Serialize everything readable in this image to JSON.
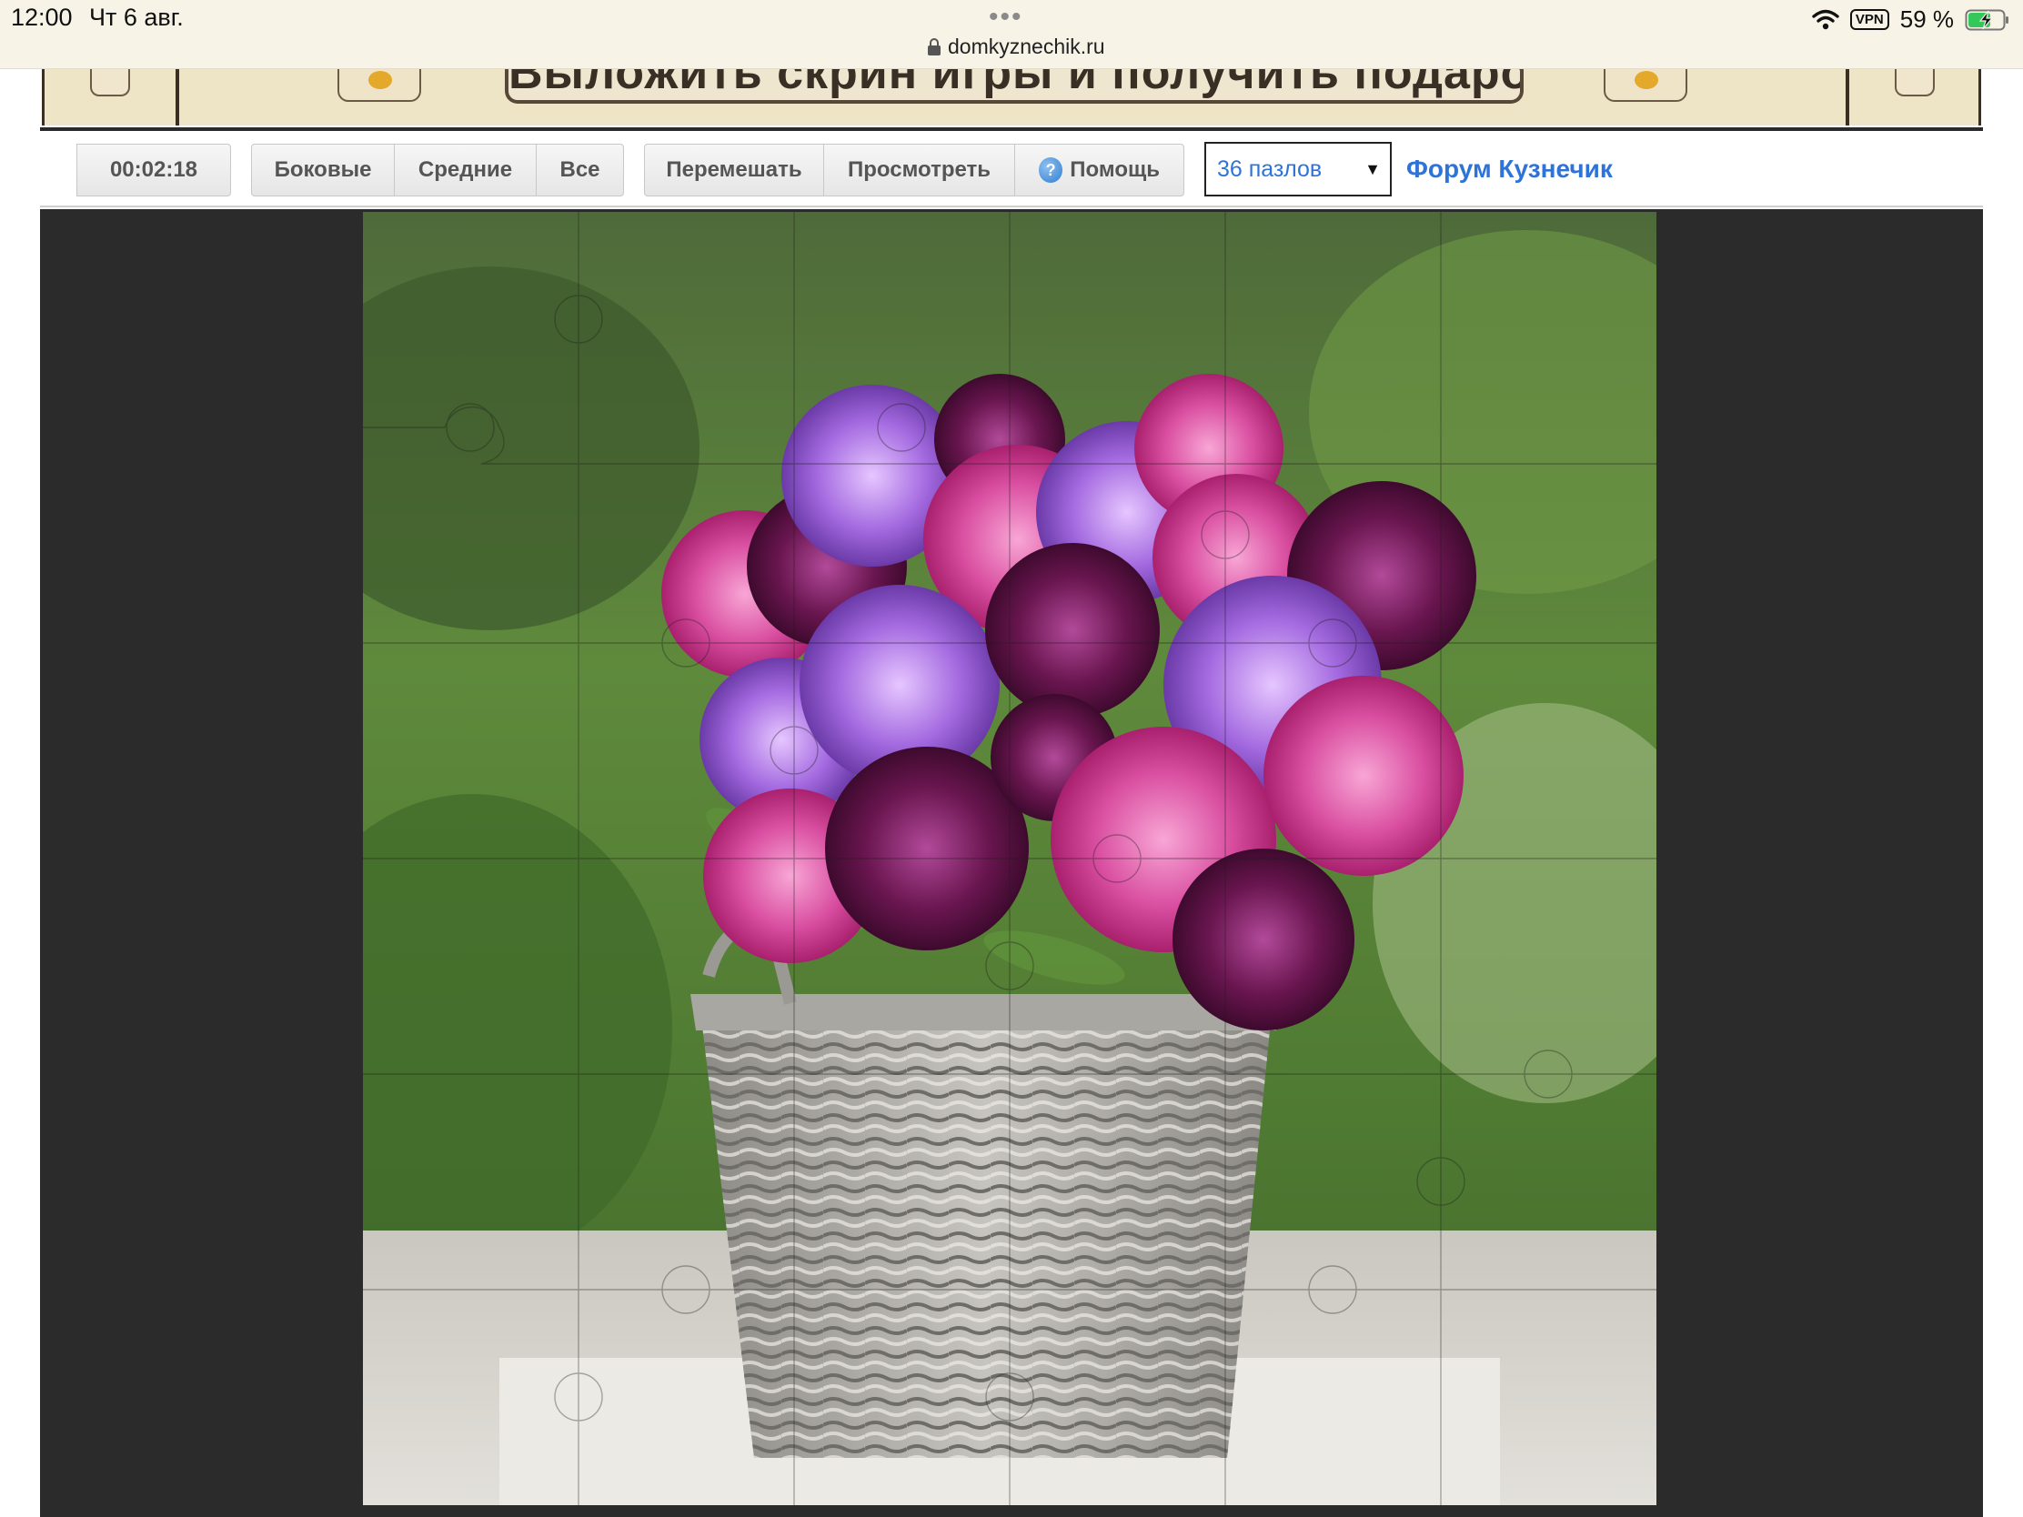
{
  "status_bar": {
    "time": "12:00",
    "date": "Чт 6 авг.",
    "dots": "•••",
    "url": "domkyznechik.ru",
    "vpn": "VPN",
    "battery": "59 %"
  },
  "banner": {
    "slogan": "Выложить скрин игры и получить подарок"
  },
  "toolbar": {
    "timer": "00:02:18",
    "filter_buttons": [
      "Боковые",
      "Средние",
      "Все"
    ],
    "shuffle_label": "Перемешать",
    "preview_label": "Просмотреть",
    "help_label": "Помощь",
    "help_icon": "?",
    "pieces_select": "36 пазлов",
    "select_arrow": "▼",
    "forum_link": "Форум Кузнечик"
  },
  "puzzle": {
    "grid_size": 6,
    "pieces": 36
  },
  "colors": {
    "status_bar_bg": "#f7f3e6",
    "banner_bg": "#eee4c6",
    "game_bg": "#2b2b2b",
    "link": "#2e73d8"
  }
}
